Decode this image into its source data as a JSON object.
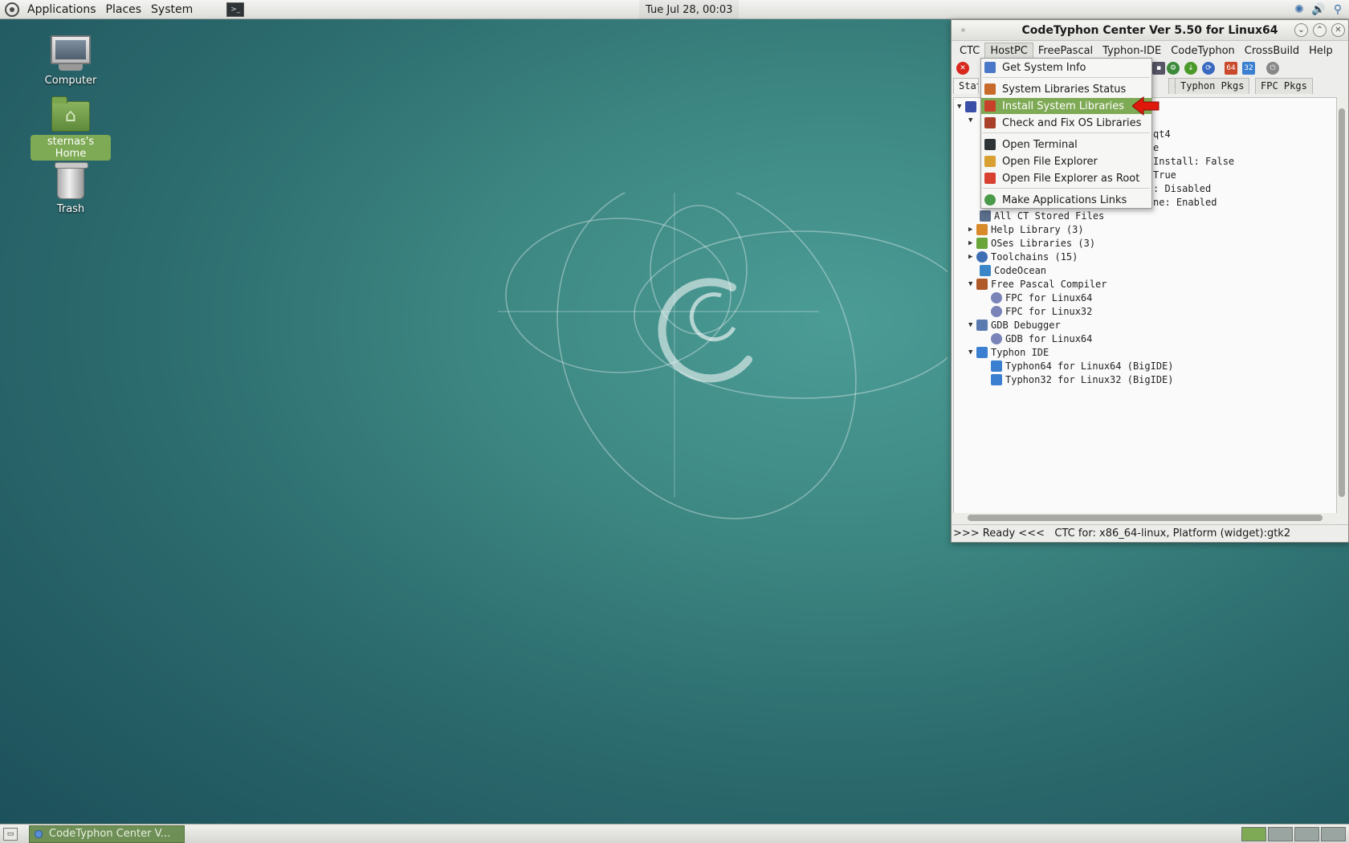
{
  "top_panel": {
    "menus": [
      "Applications",
      "Places",
      "System"
    ],
    "clock": "Tue Jul 28, 00:03"
  },
  "desktop": {
    "icons": [
      {
        "label": "Computer"
      },
      {
        "label": "sternas's Home"
      },
      {
        "label": "Trash"
      }
    ]
  },
  "window": {
    "title": "CodeTyphon Center Ver 5.50 for Linux64",
    "menubar": [
      "CTC",
      "HostPC",
      "FreePascal",
      "Typhon-IDE",
      "CodeTyphon",
      "CrossBuild",
      "Help"
    ],
    "tabs": [
      "Stat",
      "ox",
      "Typhon Pkgs",
      "FPC Pkgs"
    ],
    "tree_partial_values": [
      "qt4",
      "e",
      "Install: False",
      "True",
      ": Disabled",
      "ne: Enabled"
    ],
    "tree": [
      {
        "label": "All CT Stored Files",
        "icon_color": "#5a6e8c"
      },
      {
        "label": "Help Library (3)",
        "icon_color": "#d88a2a"
      },
      {
        "label": "OSes Libraries (3)",
        "icon_color": "#6aa53a"
      },
      {
        "label": "Toolchains (15)",
        "icon_color": "#3e6fb5"
      },
      {
        "label": "CodeOcean",
        "icon_color": "#3b86c7"
      },
      {
        "label": "Free Pascal Compiler",
        "icon_color": "#b05a2a"
      },
      {
        "label": "FPC for Linux64",
        "icon_color": "#7a84b8"
      },
      {
        "label": "FPC for Linux32",
        "icon_color": "#7a84b8"
      },
      {
        "label": "GDB Debugger",
        "icon_color": "#5a7ab0"
      },
      {
        "label": "GDB for Linux64",
        "icon_color": "#7a84b8"
      },
      {
        "label": "Typhon IDE",
        "icon_color": "#3a7fd0"
      },
      {
        "label": "Typhon64 for Linux64 (BigIDE)",
        "icon_color": "#3a7fd0"
      },
      {
        "label": "Typhon32 for Linux32 (BigIDE)",
        "icon_color": "#3a7fd0"
      }
    ],
    "status": ">>> Ready <<<   CTC for: x86_64-linux, Platform (widget):gtk2"
  },
  "hostpc_menu": {
    "items": [
      {
        "label": "Get System Info",
        "icon_color": "#4a78c8"
      },
      {
        "label": "System Libraries Status",
        "icon_color": "#c86a2a"
      },
      {
        "label": "Install System Libraries",
        "icon_color": "#c8402a"
      },
      {
        "label": "Check and Fix OS Libraries",
        "icon_color": "#a8402a"
      },
      {
        "label": "Open Terminal",
        "icon_color": "#2e3436"
      },
      {
        "label": "Open File Explorer",
        "icon_color": "#d8a030"
      },
      {
        "label": "Open File Explorer as Root",
        "icon_color": "#d84030"
      },
      {
        "label": "Make Applications Links",
        "icon_color": "#4a9a4a"
      }
    ]
  },
  "taskbar": {
    "item": "CodeTyphon Center V..."
  },
  "colors": {
    "highlight": "#7ea955",
    "arrow": "#e0180c"
  }
}
